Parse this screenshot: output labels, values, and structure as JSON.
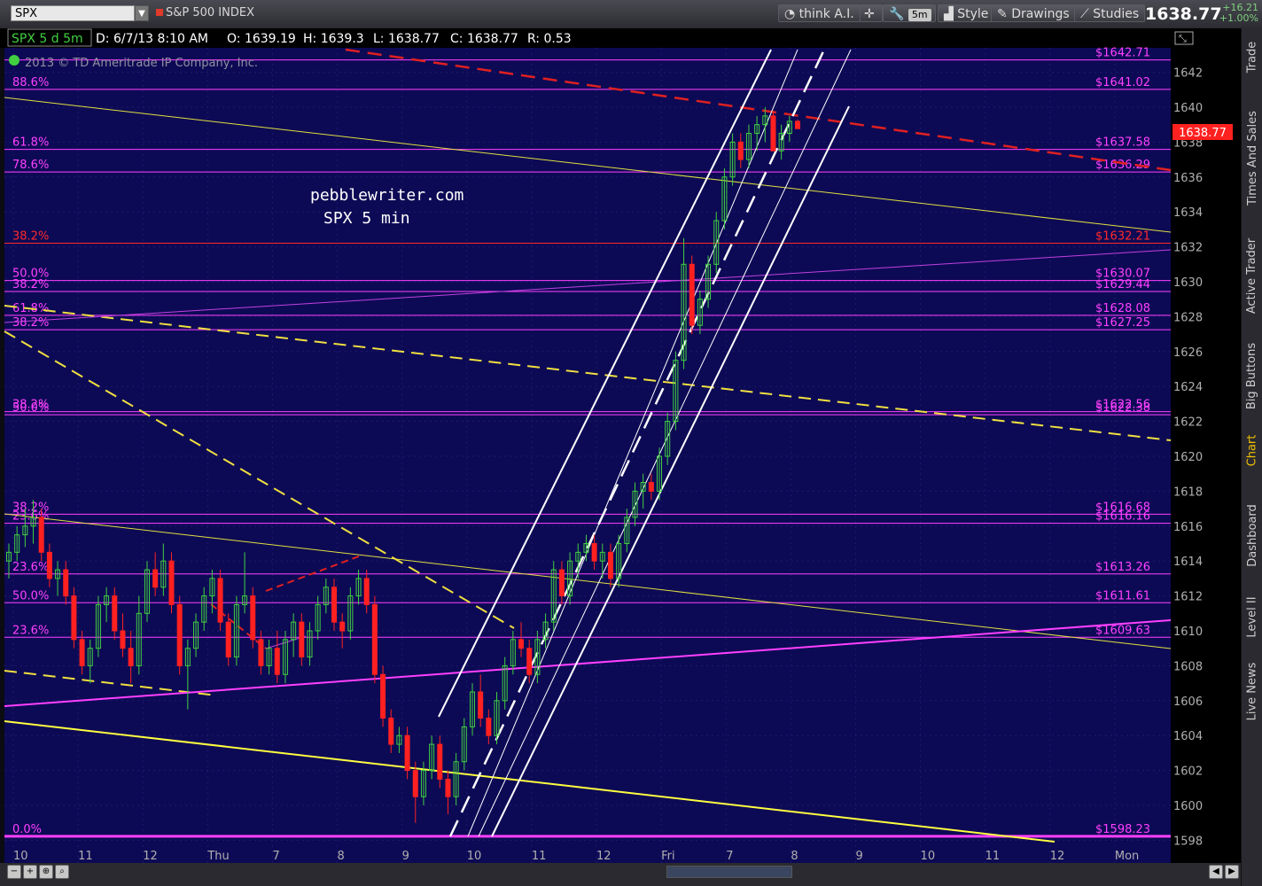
{
  "toolbar": {
    "symbol": "SPX",
    "symbol_name": "S&P 500 INDEX",
    "think_label": "think A.I.",
    "timeframe": "5m",
    "style_label": "Style",
    "drawings_label": "Drawings",
    "studies_label": "Studies",
    "last_price": "1638.77",
    "change": "+16.21",
    "change_pct": "+1.00%"
  },
  "chart_header": {
    "symbol_tf": "SPX 5 d 5m",
    "date": "D: 6/7/13 8:10 AM",
    "open": "O: 1639.19",
    "high": "H: 1639.3",
    "low": "L: 1638.77",
    "close": "C: 1638.77",
    "range": "R: 0.53",
    "copyright": "2013 © TD Ameritrade IP Company, Inc."
  },
  "watermark": {
    "line1": "pebblewriter.com",
    "line2": "SPX 5 min"
  },
  "sidebar": {
    "tabs": [
      "Trade",
      "Times And Sales",
      "Active Trader",
      "Big Buttons",
      "Chart",
      "Dashboard",
      "Level II",
      "Live News"
    ],
    "active": "Chart"
  },
  "colors": {
    "background": "#0d0a55",
    "magenta": "#ff40ff",
    "yellow": "#ffff50",
    "red": "#e02020",
    "up_candle": "#40d040",
    "down_candle": "#ff2020"
  },
  "chart_data": {
    "type": "candlestick",
    "ylim": [
      1596.6,
      1643.4
    ],
    "yticks": [
      1598,
      1600,
      1602,
      1604,
      1606,
      1608,
      1610,
      1612,
      1614,
      1616,
      1618,
      1620,
      1622,
      1624,
      1626,
      1628,
      1630,
      1632,
      1634,
      1636,
      1638,
      1640,
      1642
    ],
    "xticks": [
      "10",
      "11",
      "12",
      "Thu",
      "7",
      "8",
      "9",
      "10",
      "11",
      "12",
      "Fri",
      "7",
      "8",
      "9",
      "10",
      "11",
      "12",
      "Mon"
    ],
    "last_price_label": "1638.77",
    "levels": [
      {
        "price": 1642.71,
        "label": "$1642.71",
        "pct": "",
        "color": "#ff40ff"
      },
      {
        "price": 1641.02,
        "label": "$1641.02",
        "pct": "88.6%",
        "color": "#ff40ff"
      },
      {
        "price": 1637.58,
        "label": "$1637.58",
        "pct": "61.8%",
        "color": "#ff40ff"
      },
      {
        "price": 1636.29,
        "label": "$1636.29",
        "pct": "78.6%",
        "color": "#ff40ff"
      },
      {
        "price": 1632.21,
        "label": "$1632.21",
        "pct": "38.2%",
        "color": "#ff2a2a"
      },
      {
        "price": 1630.07,
        "label": "$1630.07",
        "pct": "50.0%",
        "color": "#ff40ff"
      },
      {
        "price": 1629.44,
        "label": "$1629.44",
        "pct": "38.2%",
        "color": "#ff40ff"
      },
      {
        "price": 1628.08,
        "label": "$1628.08",
        "pct": "61.8%",
        "color": "#ff40ff"
      },
      {
        "price": 1627.25,
        "label": "$1627.25",
        "pct": "38.2%",
        "color": "#ff40ff"
      },
      {
        "price": 1622.56,
        "label": "$1622.56",
        "pct": "38.2%",
        "color": "#ff40ff"
      },
      {
        "price": 1622.38,
        "label": "$1622.38",
        "pct": "50.0%",
        "color": "#ff40ff"
      },
      {
        "price": 1616.68,
        "label": "$1616.68",
        "pct": "38.2%",
        "color": "#ff40ff"
      },
      {
        "price": 1616.16,
        "label": "$1616.16",
        "pct": "23.6%",
        "color": "#ff40ff"
      },
      {
        "price": 1613.26,
        "label": "$1613.26",
        "pct": "23.6%",
        "color": "#ff40ff"
      },
      {
        "price": 1611.61,
        "label": "$1611.61",
        "pct": "50.0%",
        "color": "#ff40ff"
      },
      {
        "price": 1609.63,
        "label": "$1609.63",
        "pct": "23.6%",
        "color": "#ff40ff"
      },
      {
        "price": 1598.23,
        "label": "$1598.23",
        "pct": "0.0%",
        "color": "#ff40ff"
      }
    ],
    "candles": [
      [
        1614,
        1615,
        1613,
        1614.5
      ],
      [
        1614.5,
        1616,
        1614,
        1615.5
      ],
      [
        1615.5,
        1617,
        1614.8,
        1616
      ],
      [
        1616,
        1617.5,
        1615,
        1616.5
      ],
      [
        1616.5,
        1617,
        1614,
        1614.5
      ],
      [
        1614.5,
        1615,
        1612.5,
        1613
      ],
      [
        1613,
        1614,
        1612,
        1613.5
      ],
      [
        1613.5,
        1614,
        1611.5,
        1612
      ],
      [
        1612,
        1612.5,
        1609,
        1609.5
      ],
      [
        1609.5,
        1610,
        1607.5,
        1608
      ],
      [
        1608,
        1609.5,
        1607,
        1609
      ],
      [
        1609,
        1612,
        1608.5,
        1611.5
      ],
      [
        1611.5,
        1612.5,
        1610.5,
        1612
      ],
      [
        1612,
        1612.5,
        1609.5,
        1610
      ],
      [
        1610,
        1611,
        1608.5,
        1609
      ],
      [
        1609,
        1610,
        1607,
        1608
      ],
      [
        1608,
        1612,
        1607.5,
        1611
      ],
      [
        1611,
        1614,
        1610.5,
        1613.5
      ],
      [
        1613.5,
        1614.5,
        1612,
        1612.5
      ],
      [
        1612.5,
        1615,
        1612,
        1614
      ],
      [
        1614,
        1614.5,
        1611,
        1611.5
      ],
      [
        1611.5,
        1612,
        1607.5,
        1608
      ],
      [
        1608,
        1609.5,
        1605.5,
        1609
      ],
      [
        1609,
        1611,
        1608.5,
        1610.5
      ],
      [
        1610.5,
        1612.5,
        1610,
        1612
      ],
      [
        1612,
        1613.5,
        1611,
        1613
      ],
      [
        1613,
        1613.5,
        1610,
        1610.5
      ],
      [
        1610.5,
        1611,
        1608,
        1608.5
      ],
      [
        1608.5,
        1612,
        1608,
        1611.5
      ],
      [
        1611.5,
        1614.5,
        1611,
        1612
      ],
      [
        1612,
        1612.5,
        1609,
        1609.5
      ],
      [
        1609.5,
        1610,
        1607.5,
        1608
      ],
      [
        1608,
        1609.5,
        1607.5,
        1609
      ],
      [
        1609,
        1610,
        1607,
        1607.5
      ],
      [
        1607.5,
        1610,
        1607,
        1609.5
      ],
      [
        1609.5,
        1611,
        1608.5,
        1610.5
      ],
      [
        1610.5,
        1611,
        1608,
        1608.5
      ],
      [
        1608.5,
        1610.5,
        1608,
        1610
      ],
      [
        1610,
        1612,
        1609.5,
        1611.5
      ],
      [
        1611.5,
        1613,
        1611,
        1612.5
      ],
      [
        1612.5,
        1613,
        1610,
        1610.5
      ],
      [
        1610.5,
        1611,
        1609,
        1610
      ],
      [
        1610,
        1612.5,
        1609.5,
        1612
      ],
      [
        1612,
        1613.5,
        1611.5,
        1613
      ],
      [
        1613,
        1613.5,
        1611,
        1611.5
      ],
      [
        1611.5,
        1612,
        1607,
        1607.5
      ],
      [
        1607.5,
        1608,
        1604.5,
        1605
      ],
      [
        1605,
        1605.5,
        1603,
        1603.5
      ],
      [
        1603.5,
        1604.5,
        1603,
        1604
      ],
      [
        1604,
        1604.5,
        1601.5,
        1602
      ],
      [
        1602,
        1602.5,
        1599,
        1600.5
      ],
      [
        1600.5,
        1602.5,
        1600,
        1602
      ],
      [
        1602,
        1604,
        1601.5,
        1603.5
      ],
      [
        1603.5,
        1604,
        1601,
        1601.5
      ],
      [
        1601.5,
        1602,
        1599.5,
        1600.5
      ],
      [
        1600.5,
        1603,
        1600,
        1602.5
      ],
      [
        1602.5,
        1605,
        1602,
        1604.5
      ],
      [
        1604.5,
        1607,
        1604,
        1606.5
      ],
      [
        1606.5,
        1607.5,
        1604.5,
        1605
      ],
      [
        1605,
        1605.5,
        1603.5,
        1604
      ],
      [
        1604,
        1606.5,
        1603.5,
        1606
      ],
      [
        1606,
        1608.5,
        1605.5,
        1608
      ],
      [
        1608,
        1610,
        1607.5,
        1609.5
      ],
      [
        1609.5,
        1610.5,
        1608.5,
        1609
      ],
      [
        1609,
        1609.5,
        1607,
        1607.5
      ],
      [
        1607.5,
        1610,
        1607,
        1609.5
      ],
      [
        1609.5,
        1611,
        1609,
        1610.5
      ],
      [
        1610.5,
        1614,
        1610,
        1613.5
      ],
      [
        1613.5,
        1614,
        1611.5,
        1612
      ],
      [
        1612,
        1614.5,
        1611.5,
        1614
      ],
      [
        1614,
        1615,
        1613,
        1614.5
      ],
      [
        1614.5,
        1615.5,
        1614,
        1615
      ],
      [
        1615,
        1615.5,
        1613.5,
        1614
      ],
      [
        1614,
        1615,
        1613,
        1614.5
      ],
      [
        1614.5,
        1615,
        1612.5,
        1613
      ],
      [
        1613,
        1615.5,
        1612.5,
        1615
      ],
      [
        1615,
        1617,
        1614.5,
        1616.5
      ],
      [
        1616.5,
        1618.5,
        1616,
        1618
      ],
      [
        1618,
        1619,
        1617,
        1618.5
      ],
      [
        1618.5,
        1619,
        1617.5,
        1618
      ],
      [
        1618,
        1620.5,
        1617.5,
        1620
      ],
      [
        1620,
        1622.5,
        1619.5,
        1622
      ],
      [
        1622,
        1626,
        1621.5,
        1625.5
      ],
      [
        1625.5,
        1632.5,
        1625,
        1631
      ],
      [
        1631,
        1631.5,
        1627,
        1627.5
      ],
      [
        1627.5,
        1629.5,
        1627,
        1629
      ],
      [
        1629,
        1631.5,
        1628.5,
        1631
      ],
      [
        1631,
        1634,
        1630.5,
        1633.5
      ],
      [
        1633.5,
        1636.5,
        1633,
        1636
      ],
      [
        1636,
        1638.5,
        1635.5,
        1638
      ],
      [
        1638,
        1638.5,
        1636.5,
        1637
      ],
      [
        1637,
        1639,
        1636.5,
        1638.5
      ],
      [
        1638.5,
        1639.5,
        1637.5,
        1639
      ],
      [
        1639,
        1640,
        1638,
        1639.5
      ],
      [
        1639.5,
        1639.8,
        1637.5,
        1637.5
      ],
      [
        1637.5,
        1639,
        1637,
        1638.5
      ],
      [
        1638.5,
        1639.5,
        1638,
        1639.19
      ],
      [
        1639.19,
        1639.3,
        1638.77,
        1638.77
      ]
    ]
  }
}
